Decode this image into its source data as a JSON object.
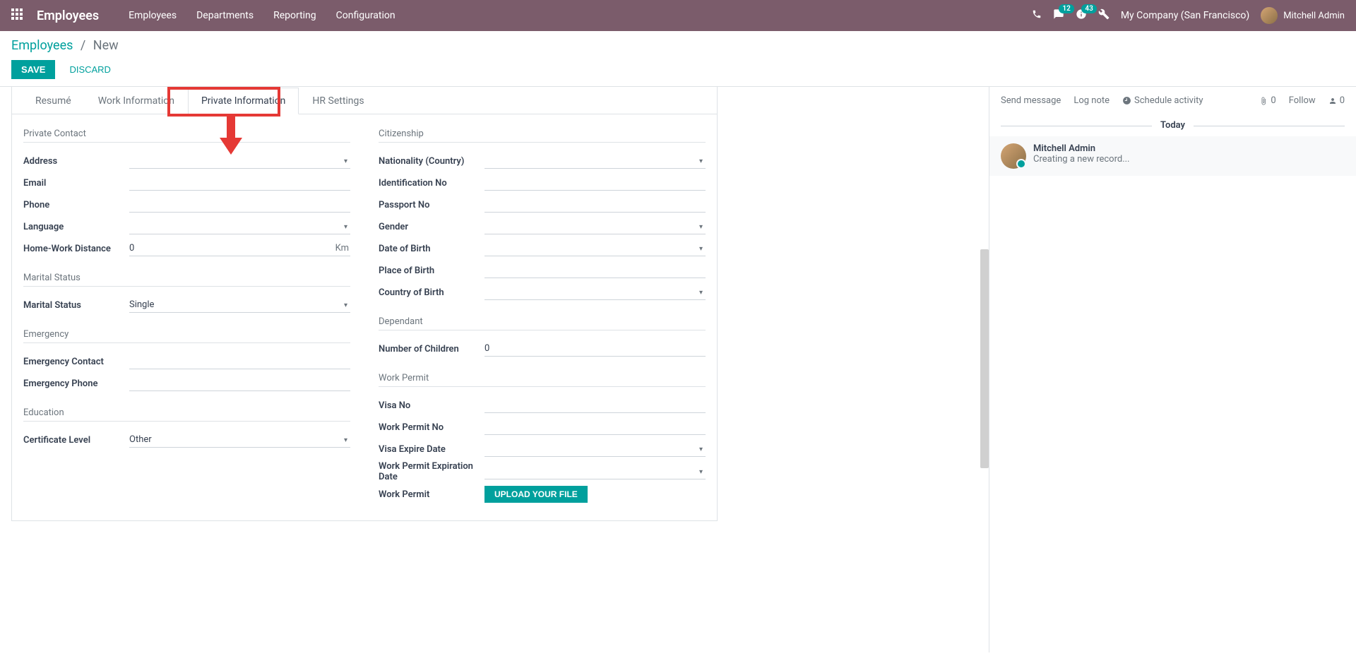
{
  "topbar": {
    "brand": "Employees",
    "nav": [
      "Employees",
      "Departments",
      "Reporting",
      "Configuration"
    ],
    "badge_messages": "12",
    "badge_activities": "43",
    "company": "My Company (San Francisco)",
    "user": "Mitchell Admin"
  },
  "breadcrumb": {
    "link": "Employees",
    "current": "New"
  },
  "buttons": {
    "save": "SAVE",
    "discard": "DISCARD"
  },
  "tabs": [
    "Resumé",
    "Work Information",
    "Private Information",
    "HR Settings"
  ],
  "sections": {
    "private_contact": {
      "title": "Private Contact",
      "address": "Address",
      "email": "Email",
      "phone": "Phone",
      "language": "Language",
      "homework": "Home-Work Distance",
      "homework_value": "0",
      "km": "Km"
    },
    "marital": {
      "title": "Marital Status",
      "status_label": "Marital Status",
      "status_value": "Single"
    },
    "emergency": {
      "title": "Emergency",
      "contact": "Emergency Contact",
      "phone": "Emergency Phone"
    },
    "education": {
      "title": "Education",
      "cert_label": "Certificate Level",
      "cert_value": "Other"
    },
    "citizenship": {
      "title": "Citizenship",
      "nationality": "Nationality (Country)",
      "idno": "Identification No",
      "passport": "Passport No",
      "gender": "Gender",
      "dob": "Date of Birth",
      "pob": "Place of Birth",
      "cob": "Country of Birth"
    },
    "dependant": {
      "title": "Dependant",
      "children_label": "Number of Children",
      "children_value": "0"
    },
    "workpermit": {
      "title": "Work Permit",
      "visa": "Visa No",
      "permit_no": "Work Permit No",
      "visa_expire": "Visa Expire Date",
      "permit_expire": "Work Permit Expiration Date",
      "permit": "Work Permit",
      "upload": "UPLOAD YOUR FILE"
    }
  },
  "chatter": {
    "send": "Send message",
    "lognote": "Log note",
    "schedule": "Schedule activity",
    "attach_count": "0",
    "follow": "Follow",
    "follower_count": "0",
    "today": "Today",
    "msg_author": "Mitchell Admin",
    "msg_text": "Creating a new record..."
  }
}
